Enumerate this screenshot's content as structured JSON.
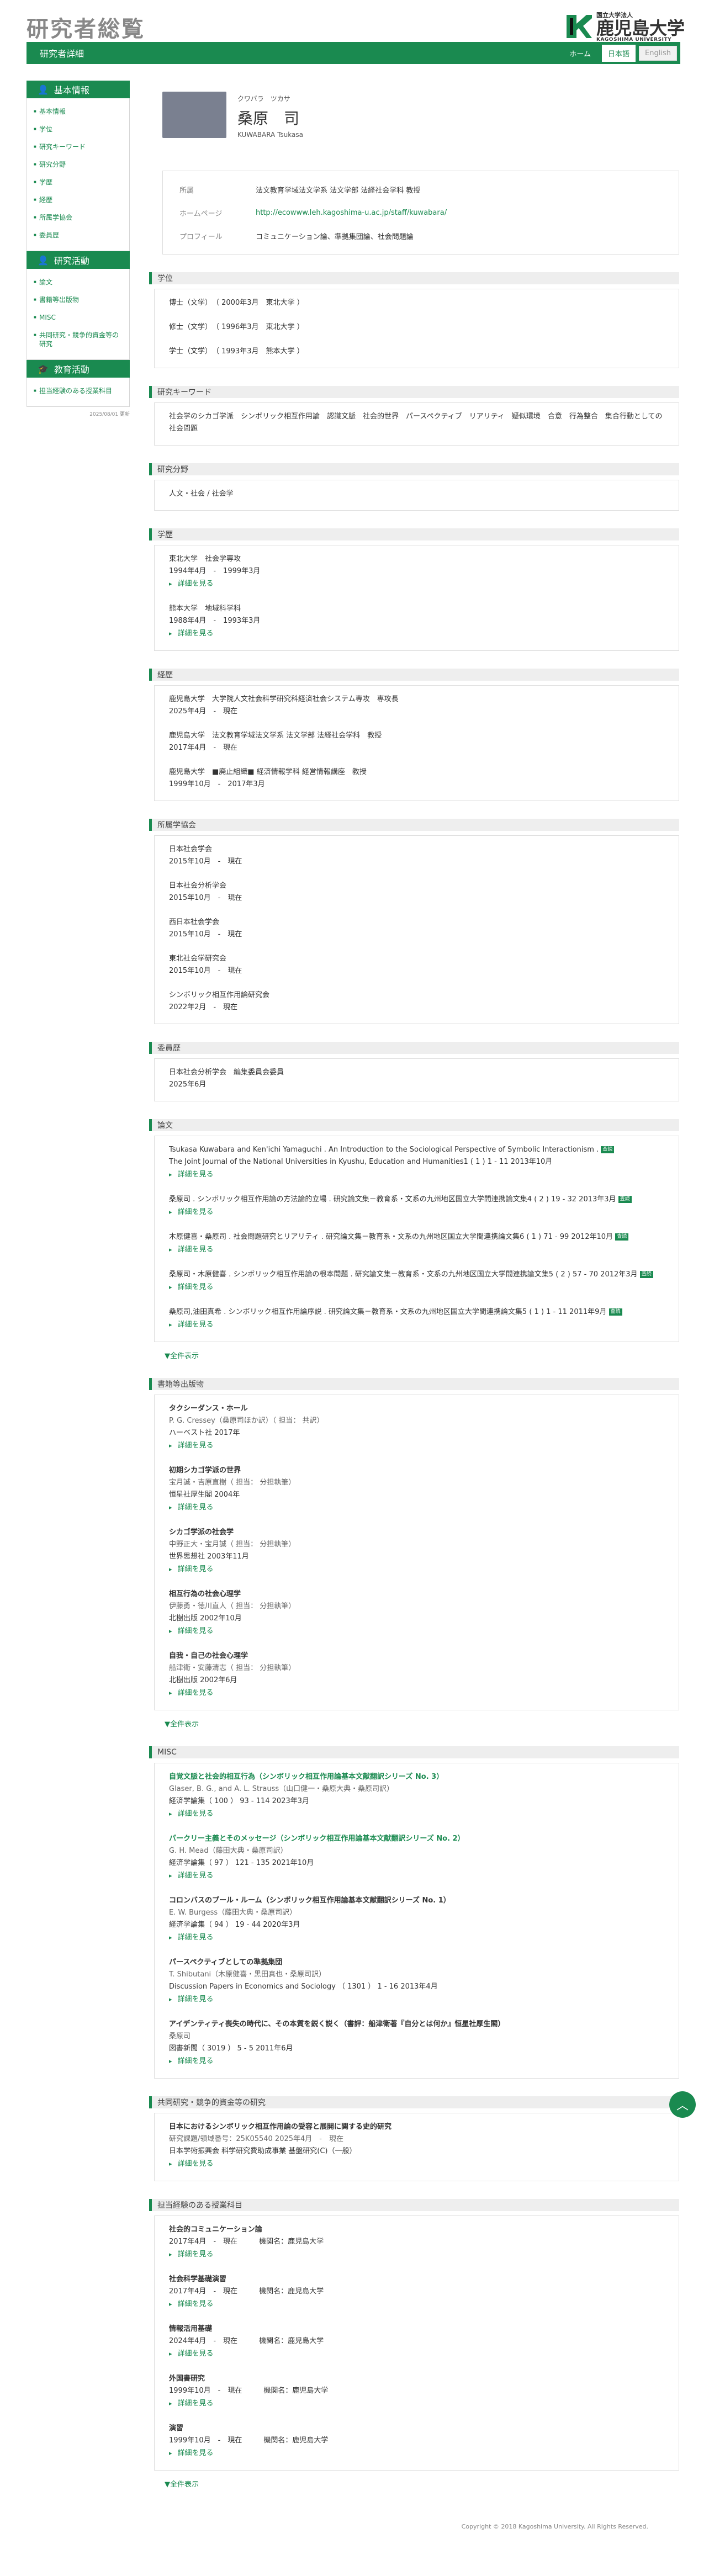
{
  "header": {
    "site_title": "研究者総覧",
    "bar_title": "研究者詳細",
    "home": "ホーム",
    "lang_ja": "日本語",
    "lang_en": "English",
    "logo": {
      "small": "国立大学法人",
      "big": "鹿児島大学",
      "en": "KAGOSHIMA UNIVERSITY",
      "colors": [
        "#1a8a50",
        "#111111"
      ]
    }
  },
  "sidebar": {
    "basic_title": "基本情報",
    "basic_items": [
      "基本情報",
      "学位",
      "研究キーワード",
      "研究分野",
      "学歴",
      "経歴",
      "所属学協会",
      "委員歴"
    ],
    "research_title": "研究活動",
    "research_items": [
      "論文",
      "書籍等出版物",
      "MISC",
      "共同研究・競争的資金等の研究"
    ],
    "edu_title": "教育活動",
    "edu_items": [
      "担当経験のある授業科目"
    ],
    "updated": "2025/08/01 更新"
  },
  "profile": {
    "kana": "クワバラ　ツカサ",
    "name": "桑原　司",
    "roma": "KUWABARA Tsukasa",
    "rows": [
      {
        "k": "所属",
        "v": "法文教育学域法文学系 法文学部 法経社会学科 教授"
      },
      {
        "k": "ホームページ",
        "v": "http://ecowww.leh.kagoshima-u.ac.jp/staff/kuwabara/"
      },
      {
        "k": "プロフィール",
        "v": "コミュニケーション論、準拠集団論、社会問題論"
      }
    ]
  },
  "degrees": {
    "title": "学位",
    "items": [
      "博士（文学）　（ 2000年3月　東北大学 ）",
      "修士（文学）　（ 1996年3月　東北大学 ）",
      "学士（文学）　（ 1993年3月　熊本大学 ）"
    ]
  },
  "keywords": {
    "title": "研究キーワード",
    "text": "社会学のシカゴ学派　シンボリック相互作用論　認識文脈　社会的世界　パースペクティブ　リアリティ　疑似環境　合意　行為整合　集合行動としての社会問題"
  },
  "fields": {
    "title": "研究分野",
    "text": "人文・社会 / 社会学"
  },
  "education": {
    "title": "学歴",
    "items": [
      {
        "a": "東北大学　社会学専攻",
        "b": "1994年4月　-　1999年3月"
      },
      {
        "a": "熊本大学　地域科学科",
        "b": "1988年4月　-　1993年3月"
      }
    ]
  },
  "career": {
    "title": "経歴",
    "items": [
      {
        "a": "鹿児島大学　大学院人文社会科学研究科経済社会システム専攻　専攻長",
        "b": "2025年4月　-　現在"
      },
      {
        "a": "鹿児島大学　法文教育学域法文学系 法文学部 法経社会学科　教授",
        "b": "2017年4月　-　現在"
      },
      {
        "a": "鹿児島大学　■廃止組織■ 経済情報学科 経営情報講座　教授",
        "b": "1999年10月　-　2017年3月"
      }
    ]
  },
  "societies": {
    "title": "所属学協会",
    "items": [
      {
        "a": "日本社会学会",
        "b": "2015年10月　-　現在"
      },
      {
        "a": "日本社会分析学会",
        "b": "2015年10月　-　現在"
      },
      {
        "a": "西日本社会学会",
        "b": "2015年10月　-　現在"
      },
      {
        "a": "東北社会学研究会",
        "b": "2015年10月　-　現在"
      },
      {
        "a": "シンボリック相互作用論研究会",
        "b": "2022年2月　-　現在"
      }
    ]
  },
  "committees": {
    "title": "委員歴",
    "items": [
      {
        "a": "日本社会分析学会　編集委員会委員",
        "b": "2025年6月"
      }
    ]
  },
  "papers": {
    "title": "論文",
    "items": [
      {
        "a": "Tsukasa Kuwabara and Ken'ichi Yamaguchi .  An Introduction to the Sociological Perspective of Symbolic Interactionism .",
        "b": "The Joint Journal of the National Universities in Kyushu, Education and Humanities1 ( 1 ) 1 - 11   2013年10月",
        "badge": "査読"
      },
      {
        "a": "桑原司 .  シンボリック相互作用論の方法論的立場 .  研究論文集－教育系・文系の九州地区国立大学間連携論文集4 ( 2 ) 19 - 32   2013年3月",
        "badge": "査読"
      },
      {
        "a": "木原健喜・桑原司 .  社会問題研究とリアリティ .  研究論文集－教育系・文系の九州地区国立大学間連携論文集6 ( 1 ) 71 - 99   2012年10月",
        "badge": "査読"
      },
      {
        "a": "桑原司・木原健喜 .  シンボリック相互作用論の根本問題 .  研究論文集－教育系・文系の九州地区国立大学間連携論文集5 ( 2 ) 57 - 70   2012年3月",
        "badge": "査読"
      },
      {
        "a": "桑原司,油田真希 .  シンボリック相互作用論序説 .  研究論文集－教育系・文系の九州地区国立大学間連携論文集5 ( 1 ) 1 - 11   2011年9月",
        "badge": "査読"
      }
    ],
    "more": "▼全件表示"
  },
  "books": {
    "title": "書籍等出版物",
    "items": [
      {
        "a": "タクシーダンス・ホール",
        "s": "P. G. Cressey（桑原司ほか訳）（ 担当： 共訳）",
        "b": "ハーベスト社   2017年"
      },
      {
        "a": "初期シカゴ学派の世界",
        "s": "宝月誠・吉原直樹（ 担当： 分担執筆）",
        "b": "恒星社厚生閣   2004年"
      },
      {
        "a": "シカゴ学派の社会学",
        "s": "中野正大・宝月誠（ 担当： 分担執筆）",
        "b": "世界思想社   2003年11月"
      },
      {
        "a": "相互行為の社会心理学",
        "s": "伊藤勇・徳川直人（ 担当： 分担執筆）",
        "b": "北樹出版   2002年10月"
      },
      {
        "a": "自我・自己の社会心理学",
        "s": "船津衛・安藤清志（ 担当： 分担執筆）",
        "b": "北樹出版   2002年6月"
      }
    ],
    "more": "▼全件表示"
  },
  "misc": {
    "title": "MISC",
    "items": [
      {
        "a": "自覚文脈と社会的相互行為（シンボリック相互作用論基本文献翻訳シリーズ No. 3）",
        "s": "Glaser, B. G., and A. L. Strauss（山口健一・桑原大典・桑原司訳）",
        "b": "経済学論集（ 100 ）  93 - 114   2023年3月",
        "g": true
      },
      {
        "a": "パークリー主義とそのメッセージ（シンボリック相互作用論基本文献翻訳シリーズ No. 2）",
        "s": "G. H. Mead（藤田大典・桑原司訳）",
        "b": "経済学論集（ 97 ）  121 - 135   2021年10月",
        "g": true
      },
      {
        "a": "コロンバスのプール・ルーム（シンボリック相互作用論基本文献翻訳シリーズ No. 1）",
        "s": "E. W. Burgess（藤田大典・桑原司訳）",
        "b": "経済学論集（ 94 ）  19 - 44   2020年3月",
        "g": false
      },
      {
        "a": "パースペクティブとしての準拠集団",
        "s": "T. Shibutani（木原健喜・黒田真也・桑原司訳）",
        "b": "Discussion Papers in Economics and Sociology （ 1301 ）  1 - 16   2013年4月",
        "g": false
      },
      {
        "a": "アイデンティティ喪失の時代に、その本質を鋭く説く（書評：船津衛著『自分とは何か』恒星社厚生閣）",
        "s": "桑原司",
        "b": "図書新聞（ 3019 ）  5 - 5   2011年6月",
        "g": false
      }
    ]
  },
  "grants": {
    "title": "共同研究・競争的資金等の研究",
    "items": [
      {
        "a": "日本におけるシンボリック相互作用論の受容と展開に関する史的研究",
        "s": "研究課題/領域番号：25K05540  2025年4月　-　現在",
        "b": "日本学術振興会  科学研究費助成事業  基盤研究(C)（一般）"
      }
    ]
  },
  "courses": {
    "title": "担当経験のある授業科目",
    "items": [
      {
        "a": "社会的コミュニケーション論",
        "b": "2017年4月　-　現在",
        "c": "機関名：鹿児島大学"
      },
      {
        "a": "社会科学基礎演習",
        "b": "2017年4月　-　現在",
        "c": "機関名：鹿児島大学"
      },
      {
        "a": "情報活用基礎",
        "b": "2024年4月　-　現在",
        "c": "機関名：鹿児島大学"
      },
      {
        "a": "外国書研究",
        "b": "1999年10月　-　現在",
        "c": "機関名：鹿児島大学"
      },
      {
        "a": "演習",
        "b": "1999年10月　-　現在",
        "c": "機関名：鹿児島大学"
      }
    ],
    "more": "▼全件表示"
  },
  "detail_label": "詳細を見る",
  "copyright": "Copyright © 2018 Kagoshima University. All Rights Reserved."
}
